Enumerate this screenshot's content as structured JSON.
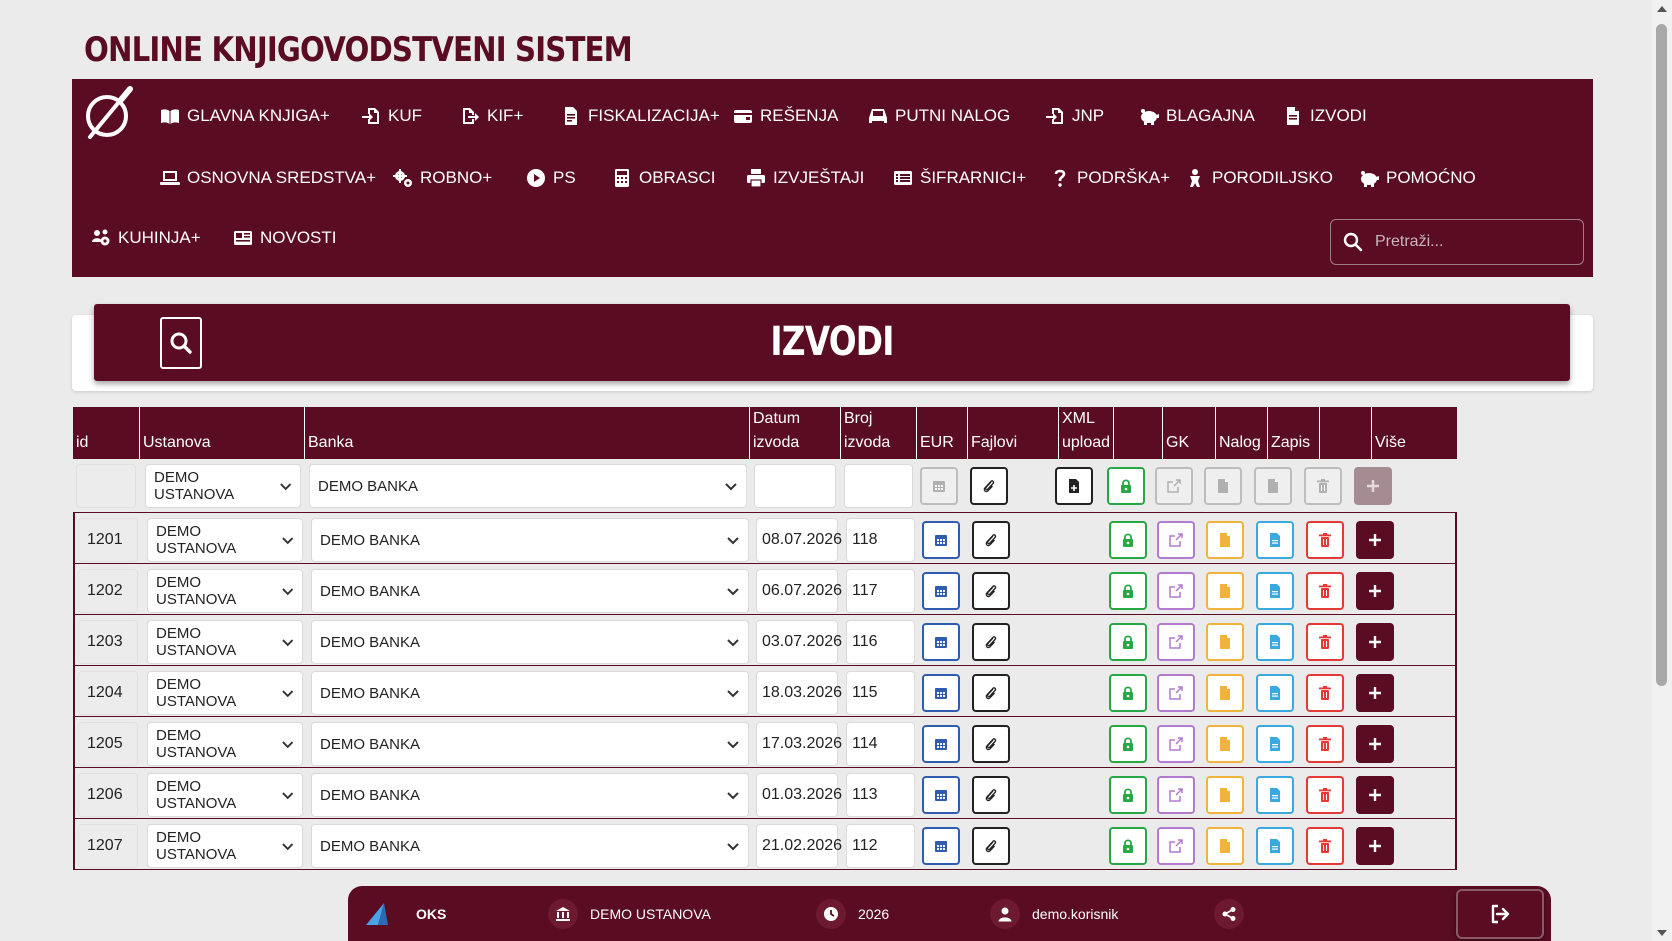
{
  "app_title": "ONLINE KNJIGOVODSTVENI SISTEM",
  "nav": {
    "items": [
      {
        "label": "GLAVNA KNJIGA+",
        "icon": "book-icon"
      },
      {
        "label": "KUF",
        "icon": "file-import-icon"
      },
      {
        "label": "KIF+",
        "icon": "file-export-icon"
      },
      {
        "label": "FISKALIZACIJA+",
        "icon": "file-invoice-icon"
      },
      {
        "label": "REŠENJA",
        "icon": "wallet-icon"
      },
      {
        "label": "PUTNI NALOG",
        "icon": "car-icon"
      },
      {
        "label": "JNP",
        "icon": "file-import-icon"
      },
      {
        "label": "BLAGAJNA",
        "icon": "piggy-bank-icon"
      },
      {
        "label": "IZVODI",
        "icon": "file-icon"
      },
      {
        "label": "OSNOVNA SREDSTVA+",
        "icon": "laptop-icon"
      },
      {
        "label": "ROBNO+",
        "icon": "cogs-icon"
      },
      {
        "label": "PS",
        "icon": "play-circle-icon"
      },
      {
        "label": "OBRASCI",
        "icon": "calculator-icon"
      },
      {
        "label": "IZVJEŠTAJI",
        "icon": "print-icon"
      },
      {
        "label": "ŠIFRARNICI+",
        "icon": "list-icon"
      },
      {
        "label": "PODRŠKA+",
        "icon": "question-icon"
      },
      {
        "label": "PORODILJSKO",
        "icon": "baby-icon"
      },
      {
        "label": "POMOĆNO",
        "icon": "piggy-bank-icon"
      },
      {
        "label": "KUHINJA+",
        "icon": "users-cog-icon"
      },
      {
        "label": "NOVOSTI",
        "icon": "newspaper-icon"
      }
    ],
    "search_placeholder": "Pretraži..."
  },
  "page_title": "IZVODI",
  "table": {
    "headers": {
      "id": "id",
      "ustanova": "Ustanova",
      "banka": "Banka",
      "datum_1": "Datum",
      "datum_2": "izvoda",
      "broj_1": "Broj",
      "broj_2": "izvoda",
      "eur": "EUR",
      "fajlovi": "Fajlovi",
      "xml_1": "XML",
      "xml_2": "upload",
      "lock": "",
      "gk": "GK",
      "nalog": "Nalog",
      "zapis": "Zapis",
      "del": "",
      "vise": "Više"
    },
    "new_row": {
      "id": "",
      "ustanova": "DEMO USTANOVA",
      "banka": "DEMO BANKA",
      "datum": "",
      "broj": ""
    },
    "rows": [
      {
        "id": "1201",
        "ustanova": "DEMO USTANOVA",
        "banka": "DEMO BANKA",
        "datum": "08.07.2026",
        "broj": "118"
      },
      {
        "id": "1202",
        "ustanova": "DEMO USTANOVA",
        "banka": "DEMO BANKA",
        "datum": "06.07.2026",
        "broj": "117"
      },
      {
        "id": "1203",
        "ustanova": "DEMO USTANOVA",
        "banka": "DEMO BANKA",
        "datum": "03.07.2026",
        "broj": "116"
      },
      {
        "id": "1204",
        "ustanova": "DEMO USTANOVA",
        "banka": "DEMO BANKA",
        "datum": "18.03.2026",
        "broj": "115"
      },
      {
        "id": "1205",
        "ustanova": "DEMO USTANOVA",
        "banka": "DEMO BANKA",
        "datum": "17.03.2026",
        "broj": "114"
      },
      {
        "id": "1206",
        "ustanova": "DEMO USTANOVA",
        "banka": "DEMO BANKA",
        "datum": "01.03.2026",
        "broj": "113"
      },
      {
        "id": "1207",
        "ustanova": "DEMO USTANOVA",
        "banka": "DEMO BANKA",
        "datum": "21.02.2026",
        "broj": "112"
      }
    ]
  },
  "footer": {
    "app": "OKS",
    "ustanova": "DEMO USTANOVA",
    "year": "2026",
    "user": "demo.korisnik"
  },
  "colors": {
    "brand": "#5a0d22",
    "calendar": "#2f5bb0",
    "lock": "#28a745",
    "gk": "#b47ad0",
    "nalog": "#f0b43c",
    "zapis": "#3aa9e0",
    "delete": "#e53935"
  }
}
